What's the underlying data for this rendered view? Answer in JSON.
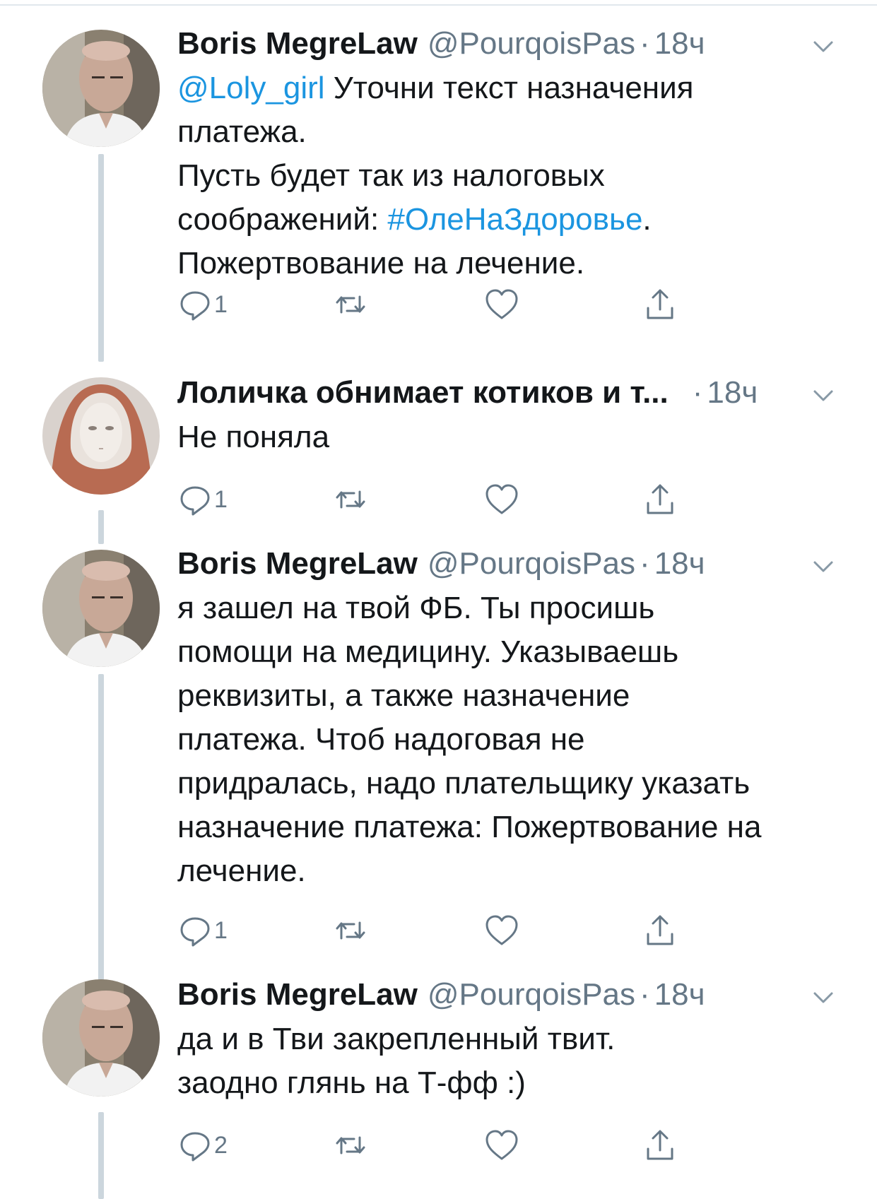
{
  "colors": {
    "link": "#1b95e0",
    "muted": "#657786",
    "text": "#14171a",
    "thread_line": "#ccd6dd"
  },
  "tweets": [
    {
      "name": "Boris MegreLaw",
      "handle": "@PourqoisPas",
      "separator": "·",
      "time": "18ч",
      "lines": [
        {
          "mention": "@Loly_girl",
          "text": " Уточни текст назначения"
        },
        {
          "text": "платежа."
        },
        {
          "text": "Пусть будет так из налоговых"
        },
        {
          "text": "соображений: ",
          "hashtag": "#ОлеНаЗдоровье",
          "tail": "."
        },
        {
          "text": "Пожертвование на лечение."
        }
      ],
      "reply_count": "1",
      "avatar_icon": "bald-man-avatar"
    },
    {
      "name": "Лоличка обнимает котиков и т...",
      "handle": "",
      "separator": "·",
      "time": "18ч",
      "lines": [
        {
          "text": "Не поняла"
        }
      ],
      "reply_count": "1",
      "avatar_icon": "hooded-mask-avatar"
    },
    {
      "name": "Boris MegreLaw",
      "handle": "@PourqoisPas",
      "separator": "·",
      "time": "18ч",
      "lines": [
        {
          "text": "я зашел на твой ФБ. Ты просишь"
        },
        {
          "text": "помощи на медицину. Указываешь"
        },
        {
          "text": "реквизиты, а также назначение"
        },
        {
          "text": "платежа. Чтоб надоговая не"
        },
        {
          "text": "придралась, надо плательщику указать"
        },
        {
          "text": "назначение платежа: Пожертвование на"
        },
        {
          "text": "лечение."
        }
      ],
      "reply_count": "1",
      "avatar_icon": "bald-man-avatar"
    },
    {
      "name": "Boris MegreLaw",
      "handle": "@PourqoisPas",
      "separator": "·",
      "time": "18ч",
      "lines": [
        {
          "text": "да и в Тви закрепленный твит."
        },
        {
          "text": "заодно глянь на Т-фф :)"
        }
      ],
      "reply_count": "2",
      "avatar_icon": "bald-man-avatar"
    }
  ]
}
